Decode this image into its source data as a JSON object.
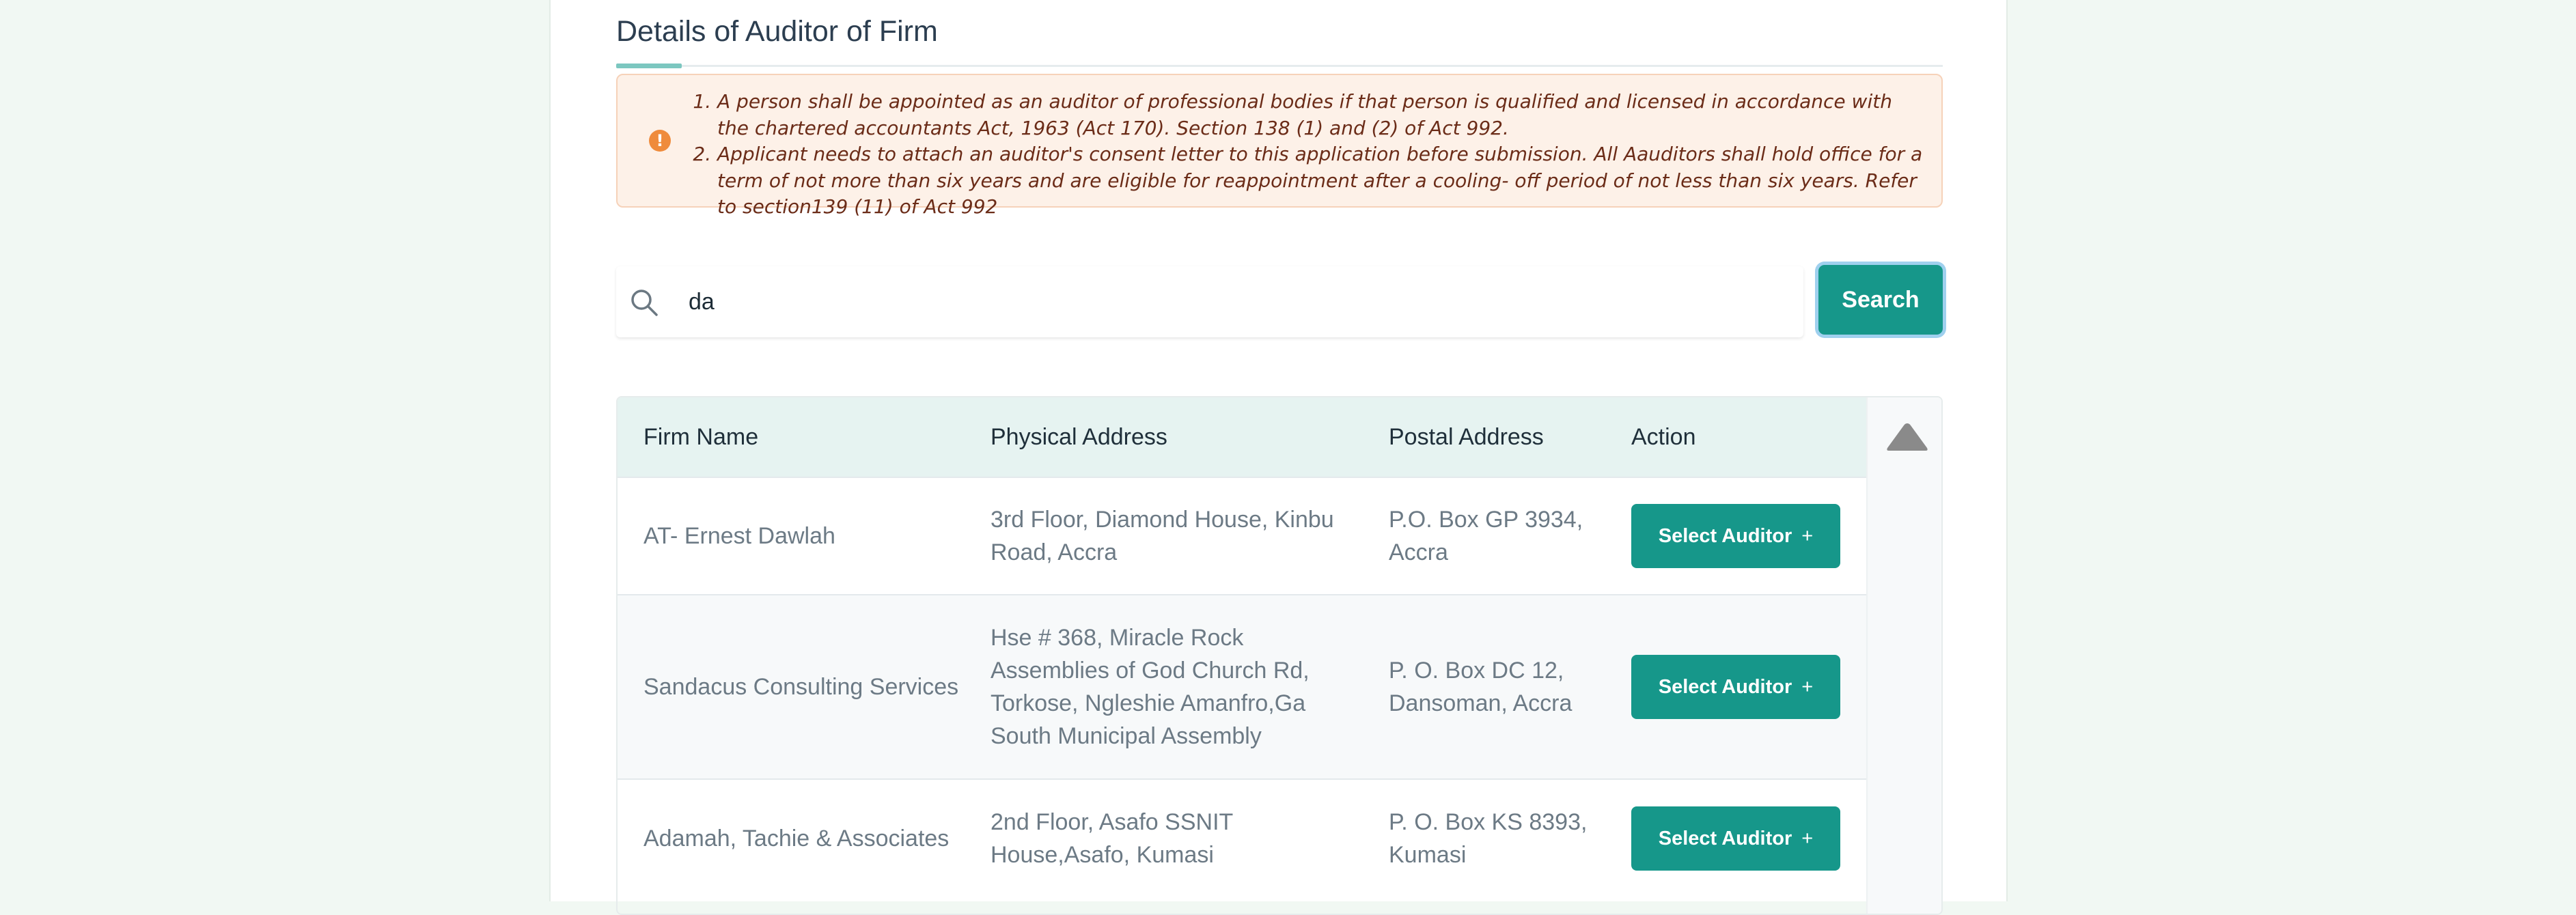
{
  "section_title": "Details of Auditor of Firm",
  "notice": {
    "items": [
      "A person shall be appointed as an auditor of professional bodies if that person is qualified and licensed in accordance with the chartered accountants Act, 1963 (Act 170). Section 138 (1) and (2) of Act 992.",
      "Applicant needs to attach an auditor's consent letter to this application before submission. All Aauditors shall hold office for a term of not more than six years and are eligible for reappointment after a cooling- off period of not less than six years. Refer to section139 (11) of Act 992"
    ],
    "icon": "warning-icon",
    "color": "#ef8b3c"
  },
  "search": {
    "value": "da",
    "button_label": "Search",
    "icon": "search-icon"
  },
  "table": {
    "headers": [
      "Firm Name",
      "Physical Address",
      "Postal Address",
      "Action"
    ],
    "rows": [
      {
        "firm_name": "AT- Ernest Dawlah",
        "physical_address": "3rd Floor, Diamond House, Kinbu Road, Accra",
        "postal_address": "P.O. Box GP 3934, Accra",
        "action_label": "Select Auditor"
      },
      {
        "firm_name": "Sandacus Consulting Services",
        "physical_address": "Hse # 368, Miracle Rock Assemblies of God Church Rd, Torkose, Ngleshie Amanfro,Ga South Municipal Assembly",
        "postal_address": "P. O. Box DC 12, Dansoman, Accra",
        "action_label": "Select Auditor"
      },
      {
        "firm_name": "Adamah, Tachie & Associates",
        "physical_address": "2nd Floor, Asafo SSNIT House,Asafo, Kumasi",
        "postal_address": "P. O. Box KS 8393, Kumasi",
        "action_label": "Select Auditor"
      }
    ],
    "action_icon": "plus-icon",
    "plus_glyph": "+",
    "scroll_icon": "scroll-up-arrow-icon"
  },
  "colors": {
    "accent": "#16978a",
    "header_bg": "#e6f3f1",
    "page_bg": "#f1f8f3"
  }
}
